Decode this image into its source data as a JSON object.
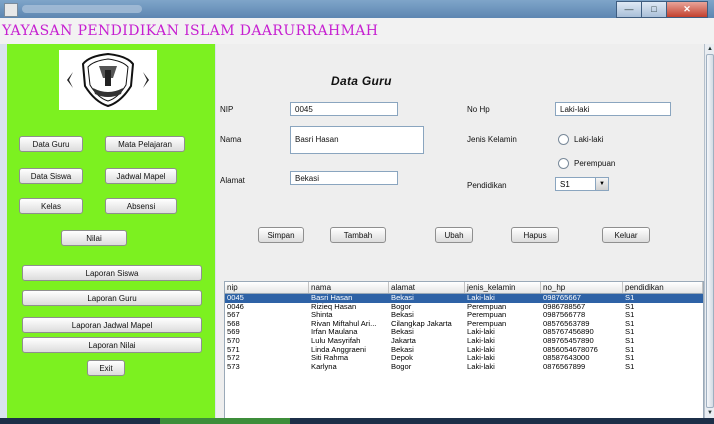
{
  "window": {
    "title_blurred": "",
    "controls": [
      "minimize",
      "maximize",
      "close"
    ]
  },
  "header": {
    "title": "YAYASAN PENDIDIKAN ISLAM DAARURRAHMAH"
  },
  "colors": {
    "sidebar": "#7cf120",
    "title": "#c61fd1",
    "selection": "#2e62a6"
  },
  "sidebar": {
    "buttons": {
      "data_guru": "Data Guru",
      "mata_pelajaran": "Mata Pelajaran",
      "data_siswa": "Data Siswa",
      "jadwal_mapel": "Jadwal Mapel",
      "kelas": "Kelas",
      "absensi": "Absensi",
      "nilai": "Nilai",
      "laporan_siswa": "Laporan Siswa",
      "laporan_guru": "Laporan Guru",
      "laporan_jadwal_mapel": "Laporan Jadwal Mapel",
      "laporan_nilai": "Laporan Nilai",
      "exit": "Exit"
    }
  },
  "form": {
    "heading": "Data Guru",
    "labels": {
      "nip": "NIP",
      "nama": "Nama",
      "alamat": "Alamat",
      "no_hp": "No Hp",
      "jenis_kelamin": "Jenis Kelamin",
      "pendidikan": "Pendidikan"
    },
    "values": {
      "nip": "0045",
      "nama": "Basri Hasan",
      "alamat": "Bekasi",
      "no_hp": "Laki-laki",
      "pendidikan": "S1"
    },
    "radio": {
      "laki": "Laki-laki",
      "perempuan": "Perempuan"
    },
    "buttons": {
      "simpan": "Simpan",
      "tambah": "Tambah",
      "ubah": "Ubah",
      "hapus": "Hapus",
      "keluar": "Keluar"
    }
  },
  "table": {
    "columns": [
      "nip",
      "nama",
      "alamat",
      "jenis_kelamin",
      "no_hp",
      "pendidikan"
    ],
    "rows": [
      [
        "0045",
        "Basri Hasan",
        "Bekasi",
        "Laki-laki",
        "098765667",
        "S1"
      ],
      [
        "0046",
        "Rizieq Hasan",
        "Bogor",
        "Perempuan",
        "0986788567",
        "S1"
      ],
      [
        "567",
        "Shinta",
        "Bekasi",
        "Perempuan",
        "0987566778",
        "S1"
      ],
      [
        "568",
        "Rivan Miftahul Ari...",
        "Cilangkap Jakarta",
        "Perempuan",
        "08576563789",
        "S1"
      ],
      [
        "569",
        "Irfan Maulana",
        "Bekasi",
        "Laki-laki",
        "085767456890",
        "S1"
      ],
      [
        "570",
        "Lulu Masyrifah",
        "Jakarta",
        "Laki-laki",
        "089765457890",
        "S1"
      ],
      [
        "571",
        "Linda Anggraeni",
        "Bekasi",
        "Laki-laki",
        "0856054678076",
        "S1"
      ],
      [
        "572",
        "Siti Rahma",
        "Depok",
        "Laki-laki",
        "08587643000",
        "S1"
      ],
      [
        "573",
        "Karlyna",
        "Bogor",
        "Laki-laki",
        "0876567899",
        "S1"
      ]
    ]
  }
}
